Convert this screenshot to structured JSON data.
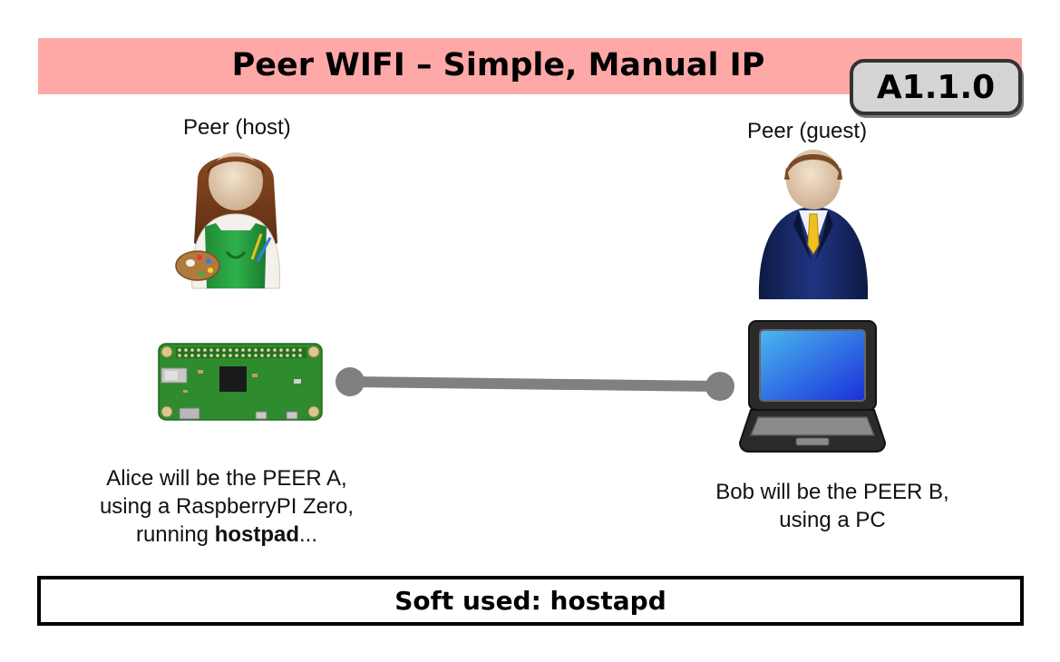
{
  "title": "Peer WIFI – Simple, Manual IP",
  "version": "A1.1.0",
  "host": {
    "role_label": "Peer (host)",
    "caption_line1": "Alice will be the PEER A,",
    "caption_line2": "using a RaspberryPI Zero,",
    "caption_line3_prefix": "running ",
    "caption_line3_bold": "hostpad",
    "caption_line3_suffix": "..."
  },
  "guest": {
    "role_label": "Peer (guest)",
    "caption_line1": "Bob will be the PEER B,",
    "caption_line2": "using a PC"
  },
  "footer": "Soft used: hostapd",
  "icons": [
    "woman-painter-icon",
    "businessman-icon",
    "raspberry-pi-zero-icon",
    "laptop-icon"
  ],
  "colors": {
    "title_bar": "#ffa8a8",
    "badge": "#d4d4d4",
    "link": "#808080",
    "board": "#2e8b2e",
    "screen": "#2b7fe0"
  }
}
